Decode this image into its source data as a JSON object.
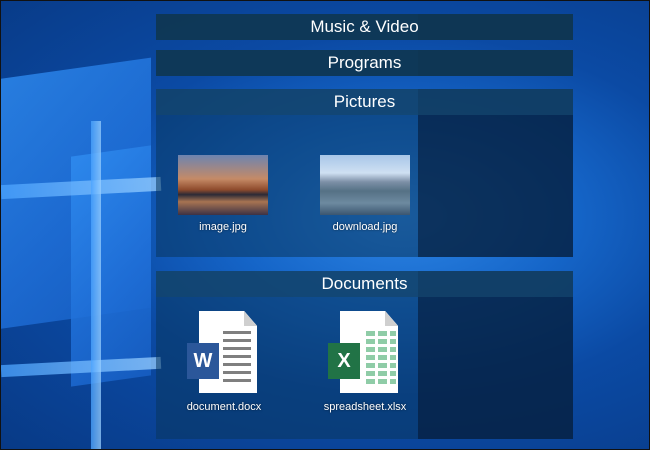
{
  "sections": {
    "music_video": {
      "label": "Music & Video"
    },
    "programs": {
      "label": "Programs"
    },
    "pictures": {
      "label": "Pictures",
      "items": [
        {
          "name": "image.jpg",
          "icon": "skyline-photo-thumbnail"
        },
        {
          "name": "download.jpg",
          "icon": "harbor-photo-thumbnail"
        }
      ]
    },
    "documents": {
      "label": "Documents",
      "items": [
        {
          "name": "document.docx",
          "icon": "word-document-icon",
          "badge": "W",
          "badge_color": "#2b579a"
        },
        {
          "name": "spreadsheet.xlsx",
          "icon": "excel-spreadsheet-icon",
          "badge": "X",
          "badge_color": "#217346"
        }
      ]
    }
  }
}
